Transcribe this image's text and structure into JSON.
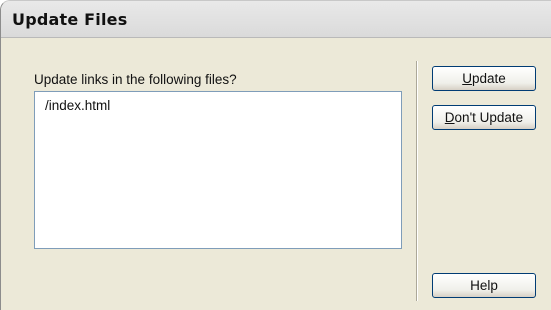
{
  "dialog": {
    "title": "Update Files",
    "prompt": "Update links in the following files?",
    "files": [
      "/index.html"
    ]
  },
  "buttons": {
    "update": {
      "mnemonic": "U",
      "rest": "pdate"
    },
    "dont_update": {
      "mnemonic": "D",
      "rest": "on't Update"
    },
    "help": {
      "label": "Help"
    }
  }
}
